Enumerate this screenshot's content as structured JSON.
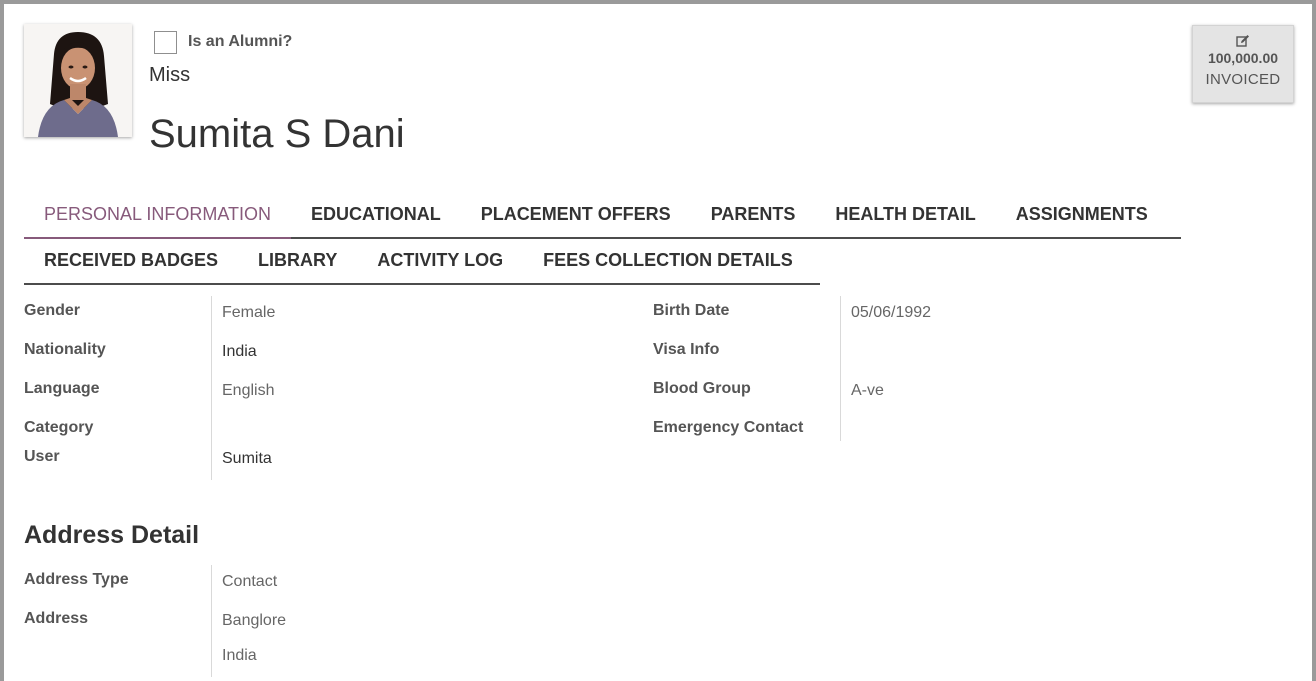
{
  "header": {
    "alumni_label": "Is an Alumni?",
    "alumni_checked": false,
    "title": "Miss",
    "name": "Sumita S Dani",
    "avatar_icon": "student-photo"
  },
  "stat_button": {
    "icon": "edit-icon",
    "value": "100,000.00",
    "label": "INVOICED"
  },
  "tabs": {
    "row1": [
      "PERSONAL INFORMATION",
      "EDUCATIONAL",
      "PLACEMENT OFFERS",
      "PARENTS",
      "HEALTH DETAIL",
      "ASSIGNMENTS"
    ],
    "row2": [
      "RECEIVED BADGES",
      "LIBRARY",
      "ACTIVITY LOG",
      "FEES COLLECTION DETAILS"
    ],
    "active": "PERSONAL INFORMATION"
  },
  "personal": {
    "left": [
      {
        "label": "Gender",
        "value": "Female"
      },
      {
        "label": "Nationality",
        "value": "India"
      },
      {
        "label": "Language",
        "value": "English"
      },
      {
        "label": "Category",
        "value": ""
      },
      {
        "label": "User",
        "value": "Sumita"
      }
    ],
    "right": [
      {
        "label": "Birth Date",
        "value": "05/06/1992"
      },
      {
        "label": "Visa Info",
        "value": ""
      },
      {
        "label": "Blood Group",
        "value": "A-ve"
      },
      {
        "label": "Emergency Contact",
        "value": ""
      }
    ]
  },
  "address": {
    "section_title": "Address Detail",
    "fields": [
      {
        "label": "Address Type",
        "value": "Contact"
      },
      {
        "label": "Address",
        "value": "Banglore"
      },
      {
        "label": "",
        "value": "India"
      }
    ]
  },
  "colors": {
    "accent": "#875a7b",
    "text": "#333333",
    "border": "#9a9a9a"
  }
}
